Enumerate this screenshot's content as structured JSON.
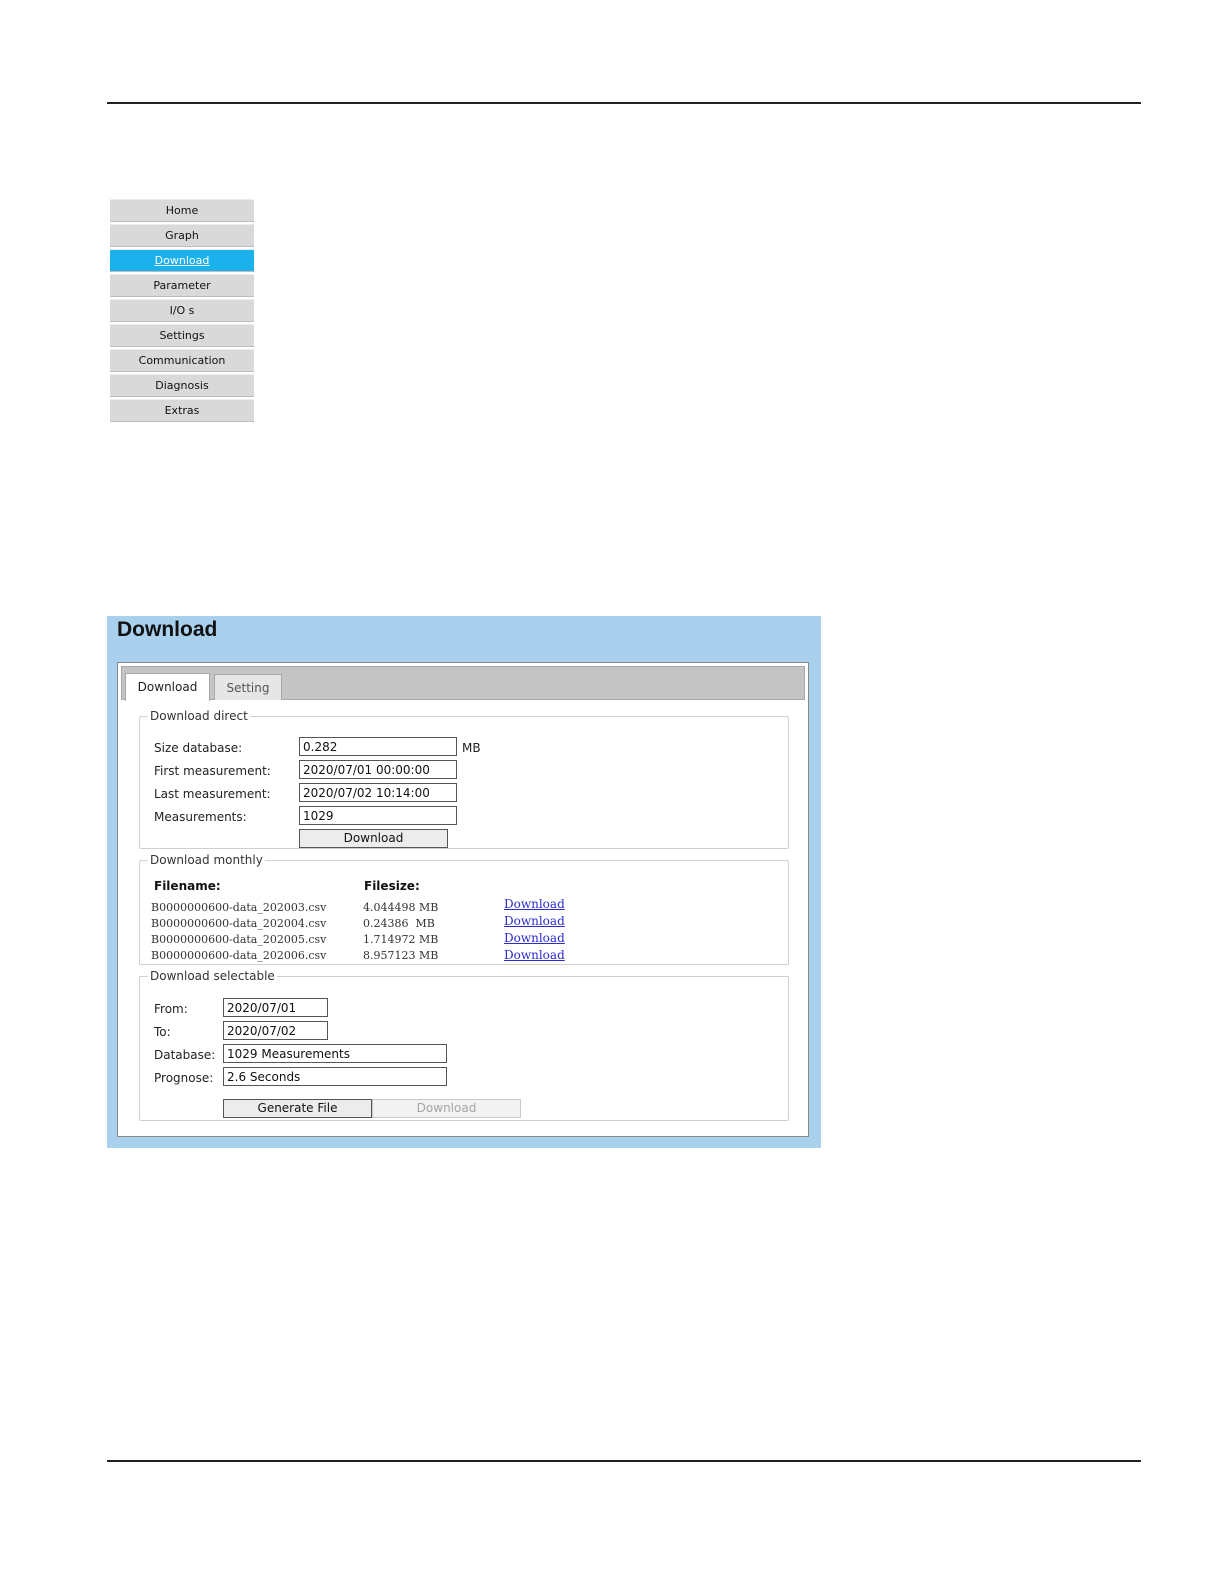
{
  "nav": {
    "items": [
      "Home",
      "Graph",
      "Download",
      "Parameter",
      "I/O s",
      "Settings",
      "Communication",
      "Diagnosis",
      "Extras"
    ],
    "active_item": "Download"
  },
  "panel": {
    "title": "Download",
    "tabs": [
      "Download",
      "Setting"
    ],
    "active_tab": "Download"
  },
  "download_direct": {
    "legend": "Download direct",
    "size_label": "Size database:",
    "size_value": "0.282",
    "size_unit": "MB",
    "first_label": "First measurement:",
    "first_value": "2020/07/01 00:00:00",
    "last_label": "Last measurement:",
    "last_value": "2020/07/02 10:14:00",
    "count_label": "Measurements:",
    "count_value": "1029",
    "button_label": "Download"
  },
  "download_monthly": {
    "legend": "Download monthly",
    "col_filename": "Filename:",
    "col_filesize": "Filesize:",
    "rows": [
      {
        "filename": "B0000000600-data_202003.csv",
        "filesize": "4.044498 MB",
        "link": "Download"
      },
      {
        "filename": "B0000000600-data_202004.csv",
        "filesize": "0.24386  MB",
        "link": "Download"
      },
      {
        "filename": "B0000000600-data_202005.csv",
        "filesize": "1.714972 MB",
        "link": "Download"
      },
      {
        "filename": "B0000000600-data_202006.csv",
        "filesize": "8.957123 MB",
        "link": "Download"
      }
    ]
  },
  "download_selectable": {
    "legend": "Download selectable",
    "from_label": "From:",
    "from_value": "2020/07/01",
    "to_label": "To:",
    "to_value": "2020/07/02",
    "database_label": "Database:",
    "database_value": "1029 Measurements",
    "prognose_label": "Prognose:",
    "prognose_value": "2.6 Seconds",
    "generate_label": "Generate File",
    "download_label": "Download"
  },
  "colors": {
    "nav_active": "#1ab1ec",
    "panel_bg": "#a9d0ec",
    "link": "#2a2ad0"
  }
}
